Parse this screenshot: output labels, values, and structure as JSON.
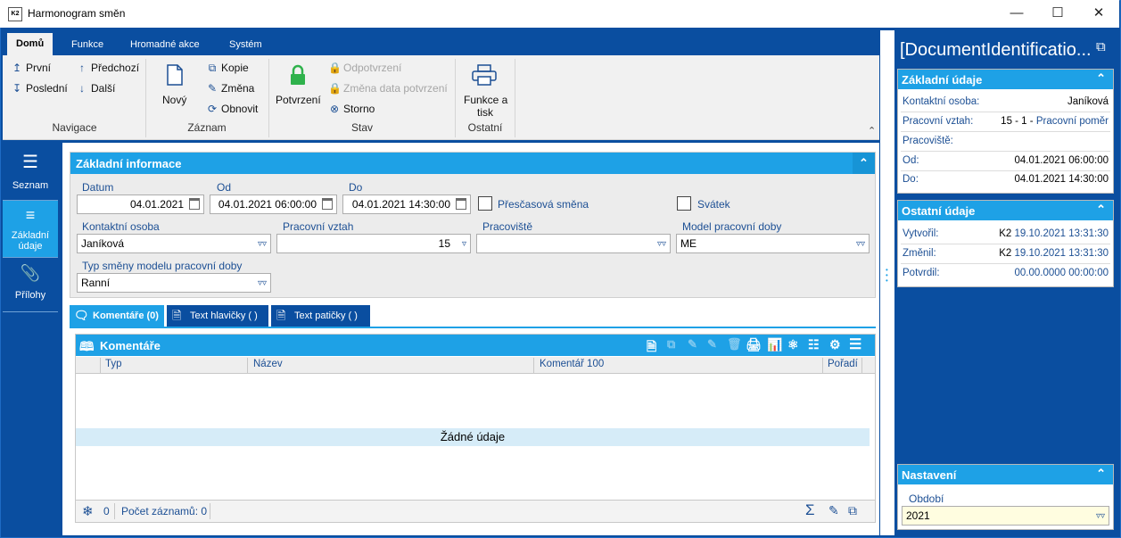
{
  "window": {
    "title": "Harmonogram směn",
    "logo_text": "K2"
  },
  "ribbon": {
    "tabs": [
      "Domů",
      "Funkce",
      "Hromadné akce",
      "Systém"
    ],
    "nav": {
      "first": "První",
      "last": "Poslední",
      "previous": "Předchozí",
      "next": "Další",
      "group": "Navigace"
    },
    "record": {
      "new": "Nový",
      "copy": "Kopie",
      "change": "Změna",
      "refresh": "Obnovit",
      "group": "Záznam"
    },
    "state": {
      "confirm": "Potvrzení",
      "unconfirm": "Odpotvrzení",
      "change_date": "Změna data potvrzení",
      "cancel": "Storno",
      "group": "Stav"
    },
    "other": {
      "print_line1": "Funkce a",
      "print_line2": "tisk",
      "group": "Ostatní"
    }
  },
  "leftnav": [
    {
      "label": "Seznam",
      "icon": "list-lines-icon"
    },
    {
      "label_line1": "Základní",
      "label_line2": "údaje",
      "icon": "details-list-icon"
    },
    {
      "label": "Přílohy",
      "icon": "paperclip-icon"
    }
  ],
  "form": {
    "section_title": "Základní informace",
    "date_label": "Datum",
    "date_value": "04.01.2021",
    "from_label": "Od",
    "from_value": "04.01.2021 06:00:00",
    "to_label": "Do",
    "to_value": "04.01.2021 14:30:00",
    "overtime_label": "Přesčasová směna",
    "holiday_label": "Svátek",
    "contact_label": "Kontaktní osoba",
    "contact_value": "Janíková",
    "relation_label": "Pracovní vztah",
    "relation_value": "15",
    "workplace_label": "Pracoviště",
    "workplace_value": "",
    "model_label": "Model pracovní doby",
    "model_value": "ME",
    "shift_type_label": "Typ směny modelu pracovní doby",
    "shift_type_value": "Ranní"
  },
  "subtabs": [
    "Komentáře (0)",
    "Text hlavičky ( )",
    "Text patičky ( )"
  ],
  "comments": {
    "title": "Komentáře",
    "columns": [
      "Typ",
      "Název",
      "Komentář 100",
      "Pořadí"
    ],
    "empty": "Žádné údaje",
    "footer_count": "0",
    "footer_records": "Počet záznamů: 0"
  },
  "right_panel": {
    "title": "[DocumentIdentificatio...",
    "basic": {
      "title": "Základní údaje",
      "rows": [
        {
          "label": "Kontaktní osoba:",
          "value": "Janíková"
        },
        {
          "label": "Pracovní vztah:",
          "value_prefix": "15 - 1 - ",
          "value": "Pracovní poměr"
        },
        {
          "label": "Pracoviště:",
          "value": ""
        },
        {
          "label": "Od:",
          "value": "04.01.2021 06:00:00"
        },
        {
          "label": "Do:",
          "value": "04.01.2021 14:30:00"
        }
      ]
    },
    "other": {
      "title": "Ostatní údaje",
      "rows": [
        {
          "label": "Vytvořil:",
          "user": "K2",
          "value": "19.10.2021 13:31:30"
        },
        {
          "label": "Změnil:",
          "user": "K2",
          "value": "19.10.2021 13:31:30"
        },
        {
          "label": "Potvrdil:",
          "user": "",
          "value": "00.00.0000 00:00:00"
        }
      ]
    },
    "settings": {
      "title": "Nastavení",
      "period_label": "Období",
      "period_value": "2021"
    }
  },
  "colors": {
    "dark_blue": "#0a4ea0",
    "light_blue": "#1ea1e6",
    "input_highlight": "#fffde0"
  }
}
